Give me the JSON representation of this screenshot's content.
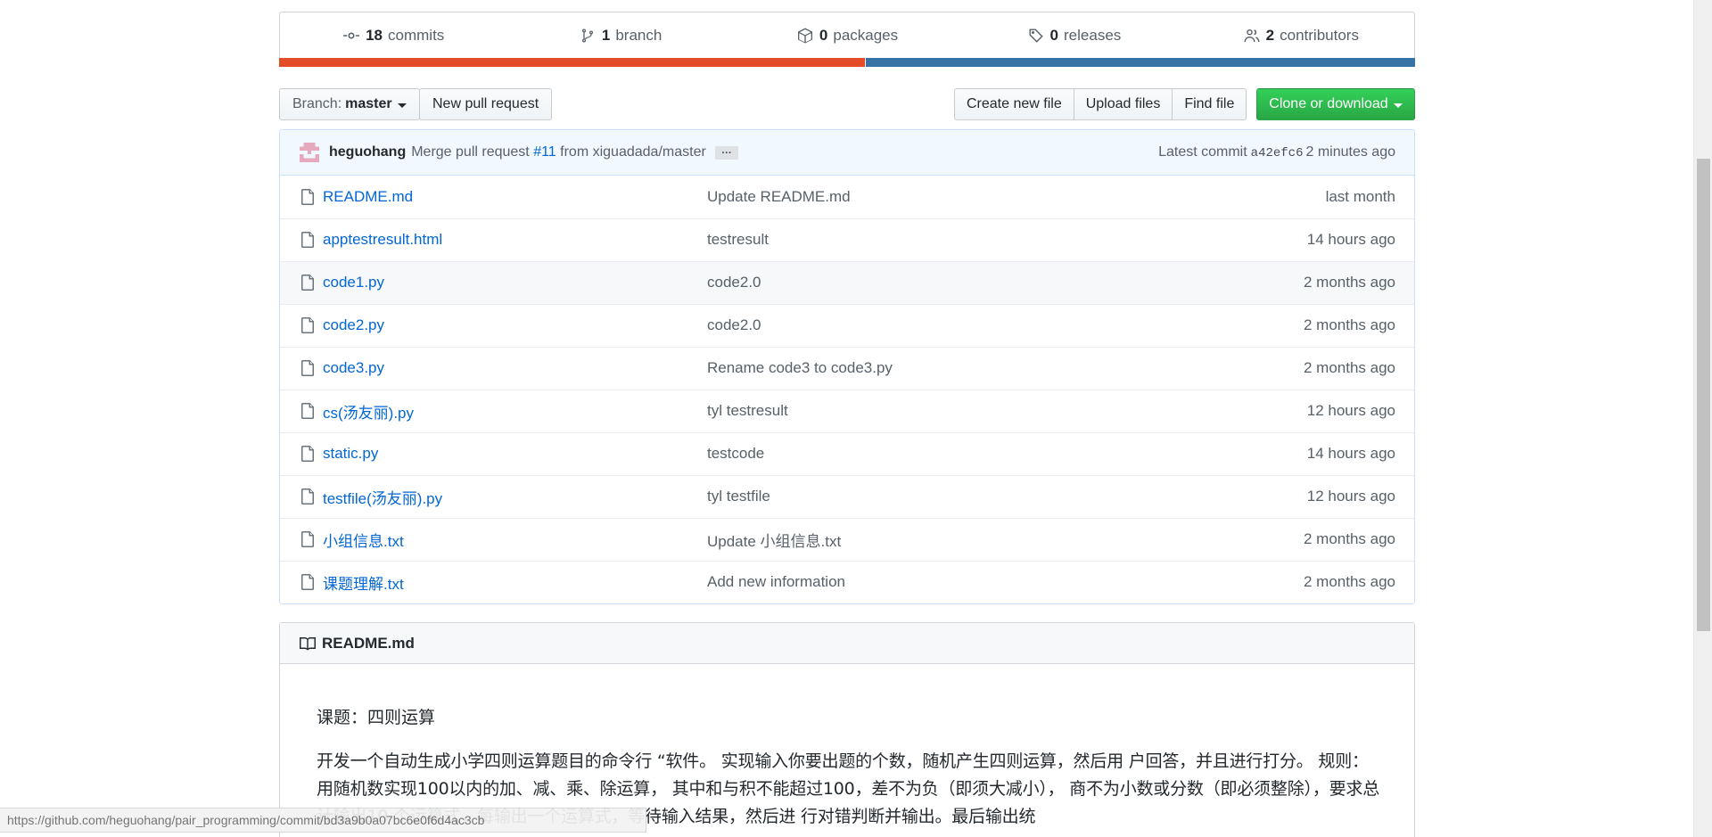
{
  "stats": {
    "commits": {
      "count": "18",
      "label": "commits"
    },
    "branches": {
      "count": "1",
      "label": "branch"
    },
    "packages": {
      "count": "0",
      "label": "packages"
    },
    "releases": {
      "count": "0",
      "label": "releases"
    },
    "contributors": {
      "count": "2",
      "label": "contributors"
    }
  },
  "languages": [
    {
      "color": "#e34c26",
      "share": 0.516
    },
    {
      "color": "#3572A5",
      "share": 0.484
    }
  ],
  "toolbar": {
    "branch_prefix": "Branch:",
    "branch_name": "master",
    "new_pr": "New pull request",
    "create_file": "Create new file",
    "upload_files": "Upload files",
    "find_file": "Find file",
    "clone": "Clone or download"
  },
  "commit": {
    "author": "heguohang",
    "message_prefix": "Merge pull request",
    "pr_number": "#11",
    "message_suffix": "from xiguadada/master",
    "ellipsis": "…",
    "latest_label": "Latest commit",
    "sha": "a42efc6",
    "age": "2 minutes ago"
  },
  "files": [
    {
      "name": "README.md",
      "message": "Update README.md",
      "age": "last month"
    },
    {
      "name": "apptestresult.html",
      "message": "testresult",
      "age": "14 hours ago"
    },
    {
      "name": "code1.py",
      "message": "code2.0",
      "age": "2 months ago"
    },
    {
      "name": "code2.py",
      "message": "code2.0",
      "age": "2 months ago"
    },
    {
      "name": "code3.py",
      "message": "Rename code3 to code3.py",
      "age": "2 months ago"
    },
    {
      "name": "cs(汤友丽).py",
      "message": "tyl testresult",
      "age": "12 hours ago"
    },
    {
      "name": "static.py",
      "message": "testcode",
      "age": "14 hours ago"
    },
    {
      "name": "testfile(汤友丽).py",
      "message": "tyl testfile",
      "age": "12 hours ago"
    },
    {
      "name": "小组信息.txt",
      "message": "Update 小组信息.txt",
      "age": "2 months ago"
    },
    {
      "name": "课题理解.txt",
      "message": "Add new information",
      "age": "2 months ago"
    }
  ],
  "readme": {
    "header": "README.md",
    "title": "课题：四则运算",
    "paragraph": "开发一个自动生成小学四则运算题目的命令行 “软件。 实现输入你要出题的个数，随机产生四则运算，然后用 户回答，并且进行打分。 规则： 用随机数实现100以内的加、减、乘、除运算， 其中和与积不能超过100，差不为负（即须大减小）， 商不为小数或分数（即必须整除），要求总计输出10 个运算式，每输出一个运算式，等待输入结果，然后进 行对错判断并输出。最后输出统"
  },
  "status_bar": {
    "url": "https://github.com/heguohang/pair_programming/commit/bd3a9b0a07bc6e0f6d4ac3cb"
  }
}
